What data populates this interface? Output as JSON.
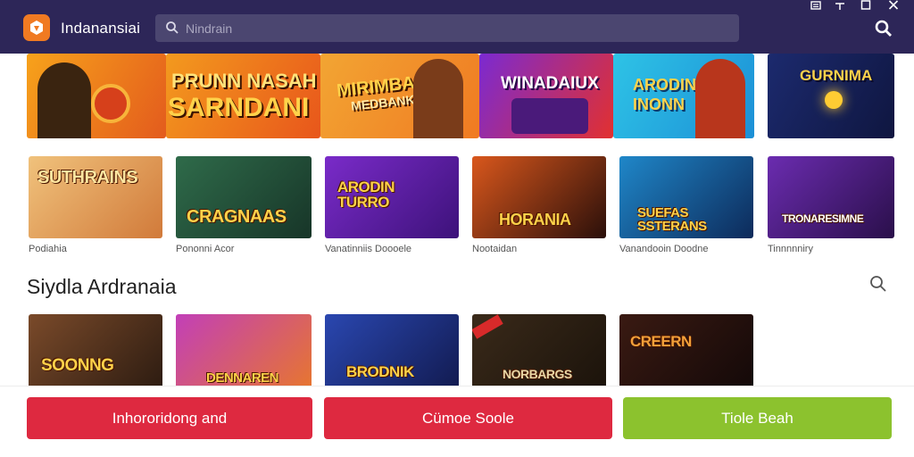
{
  "app": {
    "title": "Indanansiai",
    "accent": "#f07a22",
    "titlebar_color": "#2d2658"
  },
  "search": {
    "placeholder": "Nindrain"
  },
  "window_controls": [
    "menu-icon",
    "minimize-icon",
    "maximize-icon",
    "close-icon"
  ],
  "banners": [
    {
      "title_line1": "PRUNN NASAH",
      "title_line2": "SARNDANI",
      "colors": [
        "#f39a1e",
        "#e8561b"
      ]
    },
    {
      "title_line1": "MIRIMBANK",
      "title_line2": "MEDBANK",
      "colors": [
        "#f2a533",
        "#f07a22"
      ]
    },
    {
      "title_line1": "WINADAIUX",
      "title_line2": "",
      "colors": [
        "#7b2ad1",
        "#e2302f"
      ]
    },
    {
      "title_line1": "ARODIN",
      "title_line2": "INONN",
      "colors": [
        "#2ec3e6",
        "#1c8fd6"
      ]
    },
    {
      "title_line1": "GURNIMA",
      "title_line2": "",
      "colors": [
        "#1c2a6e",
        "#0f1640"
      ]
    }
  ],
  "featured_games": [
    {
      "title": "SUTHRAINS",
      "caption": "Podiahia",
      "colors": [
        "#f0c27c",
        "#d17a3a"
      ]
    },
    {
      "title": "CRAGNAAS",
      "caption": "Pononni Acor",
      "colors": [
        "#2f6b4a",
        "#173528"
      ]
    },
    {
      "title": "ARODIN TURRO",
      "caption": "Vanatinniis Doooele",
      "colors": [
        "#7a2bc9",
        "#3d127a"
      ]
    },
    {
      "title": "HORANIA",
      "caption": "Nootaidan",
      "colors": [
        "#d9571c",
        "#2a0f0a"
      ]
    },
    {
      "title": "SUEFAS SSTERANS",
      "caption": "Vanandooin Doodne",
      "colors": [
        "#1f87c9",
        "#0d2a5a"
      ]
    },
    {
      "title": "TRONARESIMNE",
      "caption": "Tinnnnniry",
      "colors": [
        "#6b2cb0",
        "#2a0f4a"
      ]
    }
  ],
  "section": {
    "title": "Siydla Ardranaia"
  },
  "section_games": [
    {
      "title": "SOONNG",
      "colors": [
        "#7a4a2a",
        "#2a1a10"
      ]
    },
    {
      "title": "DENNAREN",
      "colors": [
        "#c23fb8",
        "#e8782a"
      ]
    },
    {
      "title": "BRODNIK",
      "colors": [
        "#2a47b0",
        "#11194d"
      ]
    },
    {
      "title": "NORBARGS",
      "colors": [
        "#3a2a1a",
        "#1a120a"
      ]
    },
    {
      "title": "CREERN",
      "colors": [
        "#3a1a12",
        "#120808"
      ]
    }
  ],
  "actions": [
    {
      "label": "Inhororidong and",
      "color": "#de2940"
    },
    {
      "label": "Cümoe Soole",
      "color": "#de2940"
    },
    {
      "label": "Tiole Beah",
      "color": "#8cc22e"
    }
  ]
}
